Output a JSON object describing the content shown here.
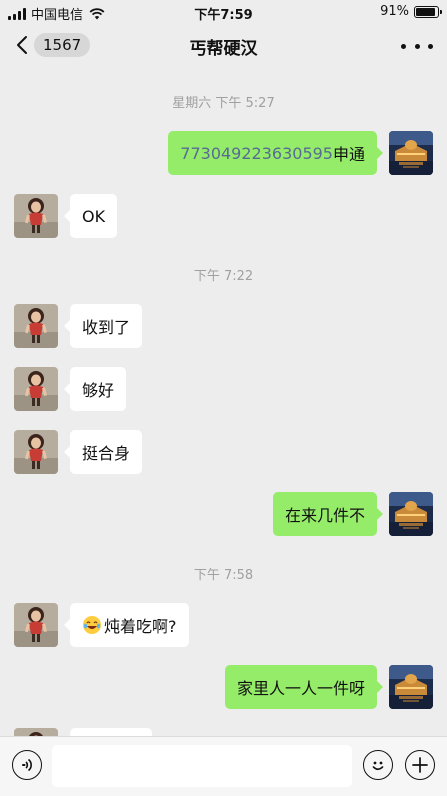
{
  "status_bar": {
    "carrier": "中国电信",
    "time": "下午7:59",
    "battery": "91%",
    "battery_level": 0.91
  },
  "nav": {
    "unread_count": "1567",
    "title": "丐帮硬汉"
  },
  "messages": {
    "ts1": "星期六 下午 5:27",
    "m1_number": "773049223630595",
    "m1_suffix": "申通",
    "m2": "OK",
    "ts2": "下午 7:22",
    "m3": "收到了",
    "m4": "够好",
    "m5": "挺合身",
    "m6": "在来几件不",
    "ts3": "下午 7:58",
    "m7": "炖着吃啊?",
    "m8": "家里人一人一件呀"
  },
  "input": {
    "placeholder": "",
    "value": ""
  },
  "icons": {
    "back": "chevron-left-icon",
    "more": "more-dots-icon",
    "voice": "voice-icon",
    "emoji": "emoji-icon",
    "plus": "plus-icon"
  },
  "colors": {
    "outgoing_bubble": "#95ec69",
    "incoming_bubble": "#ffffff",
    "link": "#576b95",
    "background": "#ededed"
  }
}
